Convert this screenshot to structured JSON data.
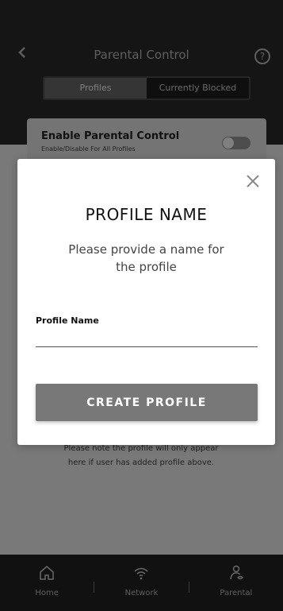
{
  "header": {
    "back_icon": "chevron-left-icon",
    "title": "Parental Control",
    "help_label": "?",
    "tabs": [
      {
        "label": "Profiles",
        "active": true
      },
      {
        "label": "Currently Blocked",
        "active": false
      }
    ]
  },
  "enable_card": {
    "title": "Enable Parental Control",
    "subtitle": "Enable/Disable For All Profiles",
    "toggle_on": false
  },
  "note": "Please note the profile will only appear here if user has added profile above.",
  "bottom_nav": {
    "items": [
      {
        "label": "Home",
        "icon": "home-icon"
      },
      {
        "label": "Network",
        "icon": "wifi-icon"
      },
      {
        "label": "Parental",
        "icon": "parental-icon"
      }
    ]
  },
  "modal": {
    "close_icon": "close-icon",
    "title": "PROFILE NAME",
    "description": "Please provide a name for the profile",
    "field_label": "Profile Name",
    "field_value": "",
    "field_placeholder": "",
    "button_label": "CREATE PROFILE"
  },
  "colors": {
    "header_bg": "#2a2a2a",
    "button_bg": "#787878",
    "nav_bg": "#222222"
  }
}
